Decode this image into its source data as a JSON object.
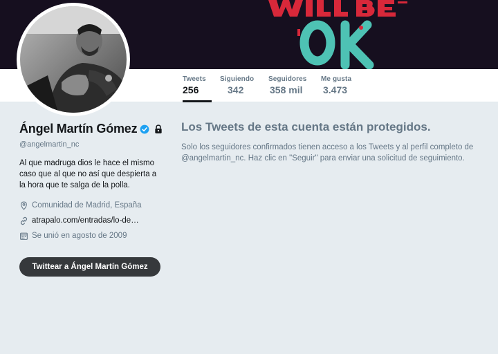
{
  "banner": {
    "art_text_top": "WILL BE",
    "art_text_bottom": "OK",
    "colors": {
      "background": "#160f1f",
      "red": "#d8283a",
      "teal": "#4ec2b4"
    }
  },
  "profile": {
    "name": "Ángel Martín Gómez",
    "handle": "@angelmartin_nc",
    "bio": "Al que madruga dios le hace el mismo caso que al que no así que despierta a la hora que te salga de la polla.",
    "location": "Comunidad de Madrid, España",
    "url": "atrapalo.com/entradas/lo-de…",
    "joined": "Se unió en agosto de 2009",
    "verified_icon": "verified-badge-icon",
    "protected_icon": "lock-icon",
    "tweet_button_label": "Twittear a Ángel Martín Gómez"
  },
  "stats": [
    {
      "label": "Tweets",
      "value": "256",
      "active": true
    },
    {
      "label": "Siguiendo",
      "value": "342",
      "active": false
    },
    {
      "label": "Seguidores",
      "value": "358 mil",
      "active": false
    },
    {
      "label": "Me gusta",
      "value": "3.473",
      "active": false
    }
  ],
  "notice": {
    "title": "Los Tweets de esta cuenta están protegidos.",
    "text": "Solo los seguidores confirmados tienen acceso a los Tweets y al perfil completo de @angelmartin_nc. Haz clic en \"Seguir\" para enviar una solicitud de seguimiento."
  },
  "colors": {
    "accent_verified": "#1da1f2",
    "text_primary": "#14171a",
    "text_secondary": "#657786",
    "page_bg": "#e6ecf0",
    "button_bg": "#36393c"
  }
}
